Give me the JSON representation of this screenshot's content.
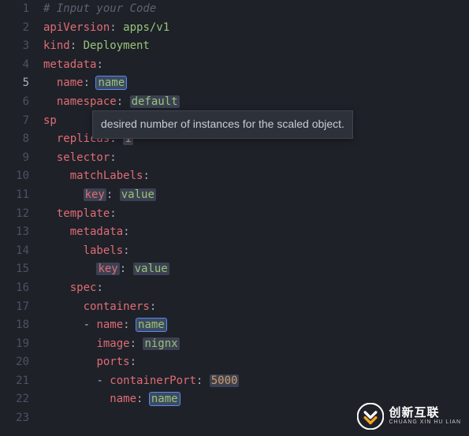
{
  "editor": {
    "tooltip": "desired number of instances for the scaled object.",
    "active_line": 5,
    "lines": [
      {
        "n": 1,
        "tokens": [
          {
            "t": "# Input your Code",
            "c": "c-comment"
          }
        ]
      },
      {
        "n": 2,
        "tokens": [
          {
            "t": "apiVersion",
            "c": "c-key"
          },
          {
            "t": ": ",
            "c": "c-colon"
          },
          {
            "t": "apps/v1",
            "c": "c-str"
          }
        ]
      },
      {
        "n": 3,
        "tokens": [
          {
            "t": "kind",
            "c": "c-key"
          },
          {
            "t": ": ",
            "c": "c-colon"
          },
          {
            "t": "Deployment",
            "c": "c-str"
          }
        ]
      },
      {
        "n": 4,
        "tokens": [
          {
            "t": "metadata",
            "c": "c-key"
          },
          {
            "t": ":",
            "c": "c-colon"
          }
        ]
      },
      {
        "n": 5,
        "indent": 1,
        "tokens": [
          {
            "t": "name",
            "c": "c-key"
          },
          {
            "t": ": ",
            "c": "c-colon"
          },
          {
            "t": "name",
            "c": "c-str",
            "ph": true,
            "active": true
          }
        ]
      },
      {
        "n": 6,
        "indent": 1,
        "tokens": [
          {
            "t": "namespace",
            "c": "c-key"
          },
          {
            "t": ": ",
            "c": "c-colon"
          },
          {
            "t": "default",
            "c": "c-str",
            "ph": true
          }
        ]
      },
      {
        "n": 7,
        "tokens": [
          {
            "t": "sp",
            "c": "c-key"
          }
        ]
      },
      {
        "n": 8,
        "indent": 1,
        "tokens": [
          {
            "t": "replicas",
            "c": "c-key"
          },
          {
            "t": ": ",
            "c": "c-colon"
          },
          {
            "t": "1",
            "c": "c-num",
            "ph": true
          }
        ]
      },
      {
        "n": 9,
        "indent": 1,
        "tokens": [
          {
            "t": "selector",
            "c": "c-key"
          },
          {
            "t": ":",
            "c": "c-colon"
          }
        ]
      },
      {
        "n": 10,
        "indent": 2,
        "tokens": [
          {
            "t": "matchLabels",
            "c": "c-key"
          },
          {
            "t": ":",
            "c": "c-colon"
          }
        ]
      },
      {
        "n": 11,
        "indent": 3,
        "tokens": [
          {
            "t": "key",
            "c": "c-key",
            "ph": true
          },
          {
            "t": ": ",
            "c": "c-colon"
          },
          {
            "t": "value",
            "c": "c-str",
            "ph": true
          }
        ]
      },
      {
        "n": 12,
        "indent": 1,
        "tokens": [
          {
            "t": "template",
            "c": "c-key"
          },
          {
            "t": ":",
            "c": "c-colon"
          }
        ]
      },
      {
        "n": 13,
        "indent": 2,
        "tokens": [
          {
            "t": "metadata",
            "c": "c-key"
          },
          {
            "t": ":",
            "c": "c-colon"
          }
        ]
      },
      {
        "n": 14,
        "indent": 3,
        "tokens": [
          {
            "t": "labels",
            "c": "c-key"
          },
          {
            "t": ":",
            "c": "c-colon"
          }
        ]
      },
      {
        "n": 15,
        "indent": 4,
        "tokens": [
          {
            "t": "key",
            "c": "c-key",
            "ph": true
          },
          {
            "t": ": ",
            "c": "c-colon"
          },
          {
            "t": "value",
            "c": "c-str",
            "ph": true
          }
        ]
      },
      {
        "n": 16,
        "indent": 2,
        "tokens": [
          {
            "t": "spec",
            "c": "c-key"
          },
          {
            "t": ":",
            "c": "c-colon"
          }
        ]
      },
      {
        "n": 17,
        "indent": 3,
        "tokens": [
          {
            "t": "containers",
            "c": "c-key"
          },
          {
            "t": ":",
            "c": "c-colon"
          }
        ]
      },
      {
        "n": 18,
        "indent": 3,
        "tokens": [
          {
            "t": "- ",
            "c": "c-dash"
          },
          {
            "t": "name",
            "c": "c-key"
          },
          {
            "t": ": ",
            "c": "c-colon"
          },
          {
            "t": "name",
            "c": "c-str",
            "ph": true,
            "active": true
          }
        ]
      },
      {
        "n": 19,
        "indent": 4,
        "tokens": [
          {
            "t": "image",
            "c": "c-key"
          },
          {
            "t": ": ",
            "c": "c-colon"
          },
          {
            "t": "nignx",
            "c": "c-str",
            "ph": true
          }
        ]
      },
      {
        "n": 20,
        "indent": 4,
        "tokens": [
          {
            "t": "ports",
            "c": "c-key"
          },
          {
            "t": ":",
            "c": "c-colon"
          }
        ]
      },
      {
        "n": 21,
        "indent": 4,
        "tokens": [
          {
            "t": "- ",
            "c": "c-dash"
          },
          {
            "t": "containerPort",
            "c": "c-key"
          },
          {
            "t": ": ",
            "c": "c-colon"
          },
          {
            "t": "5000",
            "c": "c-num",
            "ph": true
          }
        ]
      },
      {
        "n": 22,
        "indent": 5,
        "tokens": [
          {
            "t": "name",
            "c": "c-key"
          },
          {
            "t": ": ",
            "c": "c-colon"
          },
          {
            "t": "name",
            "c": "c-str",
            "ph": true,
            "active": true
          }
        ]
      },
      {
        "n": 23,
        "tokens": []
      }
    ]
  },
  "logo": {
    "main": "创新互联",
    "sub": "CHUANG XIN HU LIAN"
  }
}
